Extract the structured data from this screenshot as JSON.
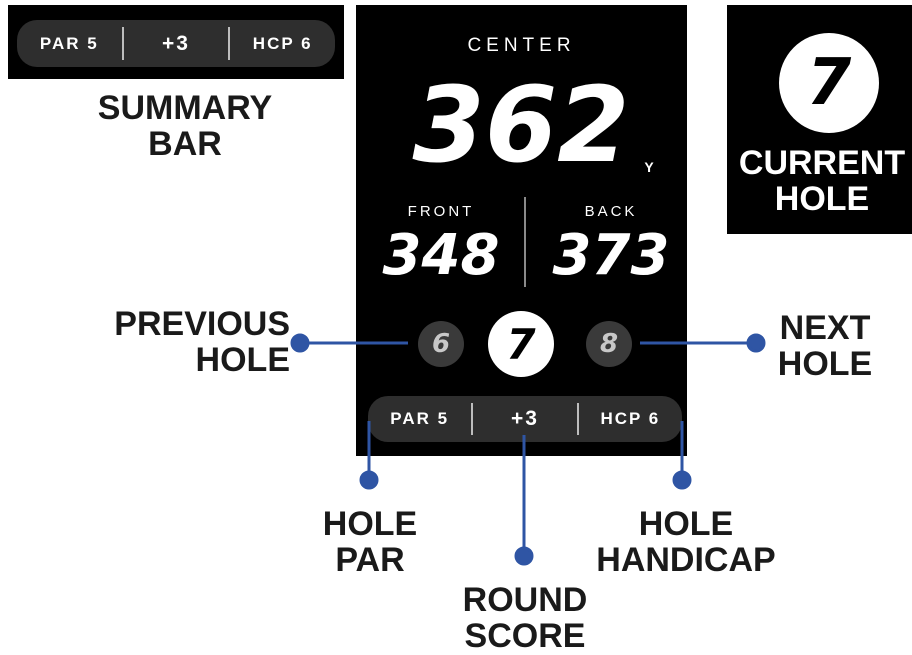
{
  "summary_bar_panel": {
    "par": "PAR 5",
    "score": "+3",
    "hcp": "HCP 6"
  },
  "labels": {
    "summary_bar": [
      "SUMMARY",
      "BAR"
    ],
    "current_hole": [
      "CURRENT",
      "HOLE"
    ],
    "previous_hole": [
      "PREVIOUS",
      "HOLE"
    ],
    "next_hole": [
      "NEXT",
      "HOLE"
    ],
    "hole_par": [
      "HOLE",
      "PAR"
    ],
    "round_score": [
      "ROUND",
      "SCORE"
    ],
    "hole_handicap": [
      "HOLE",
      "HANDICAP"
    ]
  },
  "current_hole_panel": {
    "number": "7"
  },
  "device": {
    "center_label": "CENTER",
    "center_distance": "362",
    "unit": "Y",
    "front_label": "FRONT",
    "front_distance": "348",
    "back_label": "BACK",
    "back_distance": "373",
    "previous_hole": "6",
    "current_hole": "7",
    "next_hole": "8",
    "bar": {
      "par": "PAR 5",
      "score": "+3",
      "hcp": "HCP 6"
    }
  },
  "colors": {
    "connector": "#2f55a4",
    "panel": "#000000",
    "pill": "#2e2e2e",
    "inactive_hole": "#3a3a3a"
  }
}
